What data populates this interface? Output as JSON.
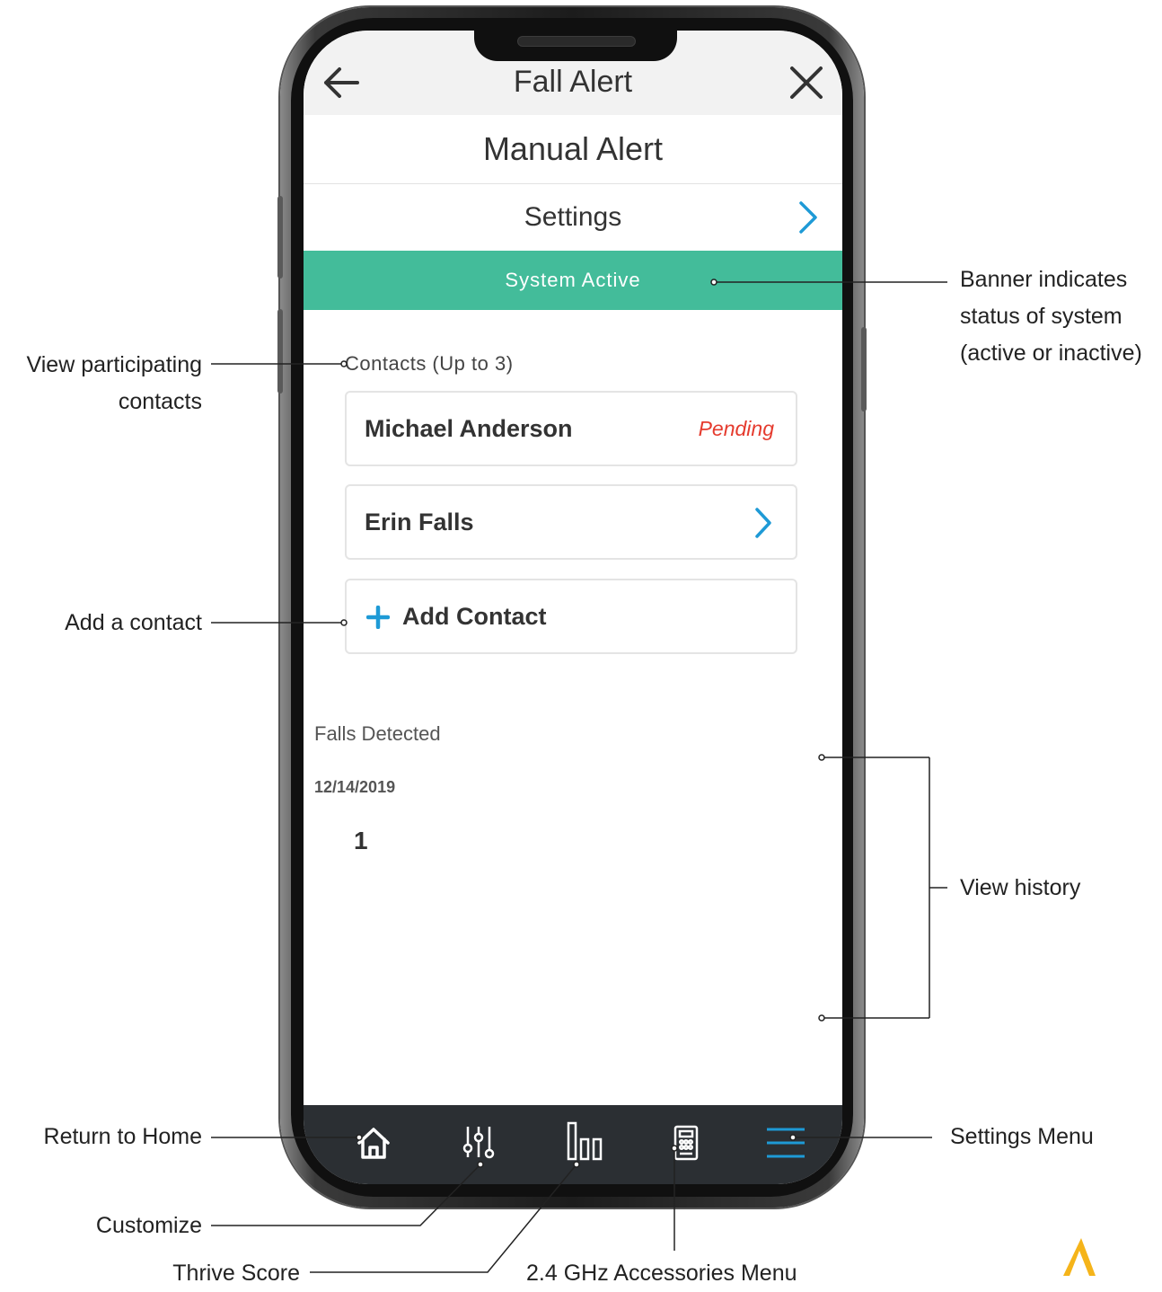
{
  "app": {
    "nav_title": "Fall Alert",
    "subtitle": "Manual Alert",
    "settings_label": "Settings",
    "banner_status": "System Active"
  },
  "contacts": {
    "heading": "Contacts (Up to 3)",
    "items": [
      {
        "name": "Michael Anderson",
        "status": "Pending"
      },
      {
        "name": "Erin Falls",
        "status": ""
      }
    ],
    "add_label": "Add Contact"
  },
  "falls": {
    "heading": "Falls Detected",
    "entries": [
      {
        "date": "12/14/2019",
        "count": "1"
      }
    ]
  },
  "tabbar": {
    "items": [
      "home-icon",
      "sliders-icon",
      "bar-chart-icon",
      "keypad-icon",
      "menu-icon"
    ]
  },
  "annotations": {
    "banner": [
      "Banner indicates",
      "status of system",
      "(active or inactive)"
    ],
    "contacts": [
      "View participating",
      "contacts"
    ],
    "add_contact": "Add a contact",
    "history": "View history",
    "home": "Return to Home",
    "settings_menu": "Settings Menu",
    "customize": "Customize",
    "thrive": "Thrive Score",
    "accessories": "2.4 GHz Accessories Menu"
  },
  "colors": {
    "banner": "#43bc9a",
    "accent": "#1e9ad6",
    "pending": "#e53b2e",
    "tabbar": "#2b2f33",
    "logo": "#f5b41a"
  }
}
